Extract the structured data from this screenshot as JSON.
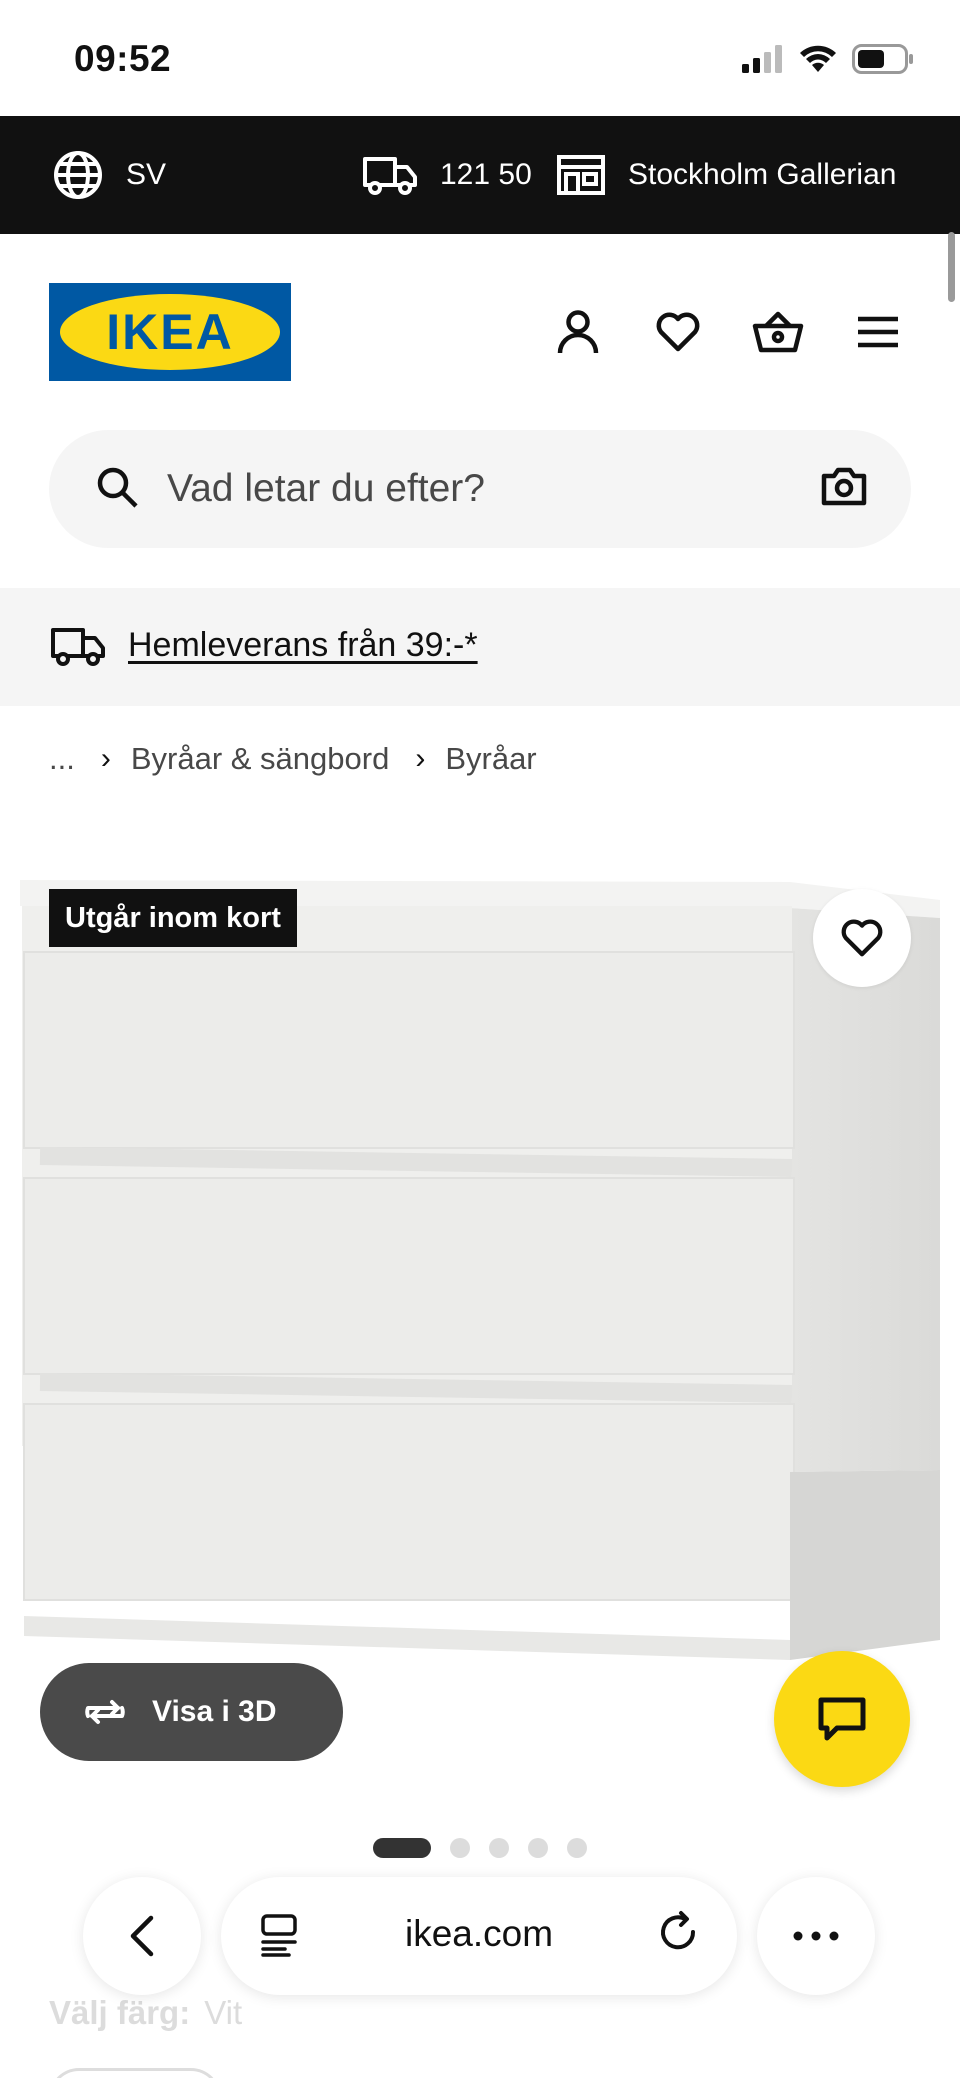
{
  "status_bar": {
    "time": "09:52"
  },
  "top_bar": {
    "language": "SV",
    "postal_code": "121 50",
    "store": "Stockholm Gallerian"
  },
  "header": {
    "logo_text": "IKEA",
    "icons": [
      "account-icon",
      "heart-icon",
      "basket-icon",
      "menu-icon"
    ]
  },
  "search": {
    "placeholder": "Vad letar du efter?"
  },
  "banner": {
    "text": "Hemleverans från 39:-*"
  },
  "breadcrumb": {
    "ellipsis": "...",
    "items": [
      "Byråar & sängbord",
      "Byråar"
    ]
  },
  "product": {
    "badge": "Utgår inom kort",
    "view3d_label": "Visa i 3D",
    "image_count": 5,
    "active_image": 1
  },
  "color_select": {
    "label": "Välj färg:",
    "value": "Vit"
  },
  "safari": {
    "url": "ikea.com"
  },
  "colors": {
    "ikea_blue": "#0058a3",
    "ikea_yellow": "#fbd914",
    "dark": "#111111"
  }
}
